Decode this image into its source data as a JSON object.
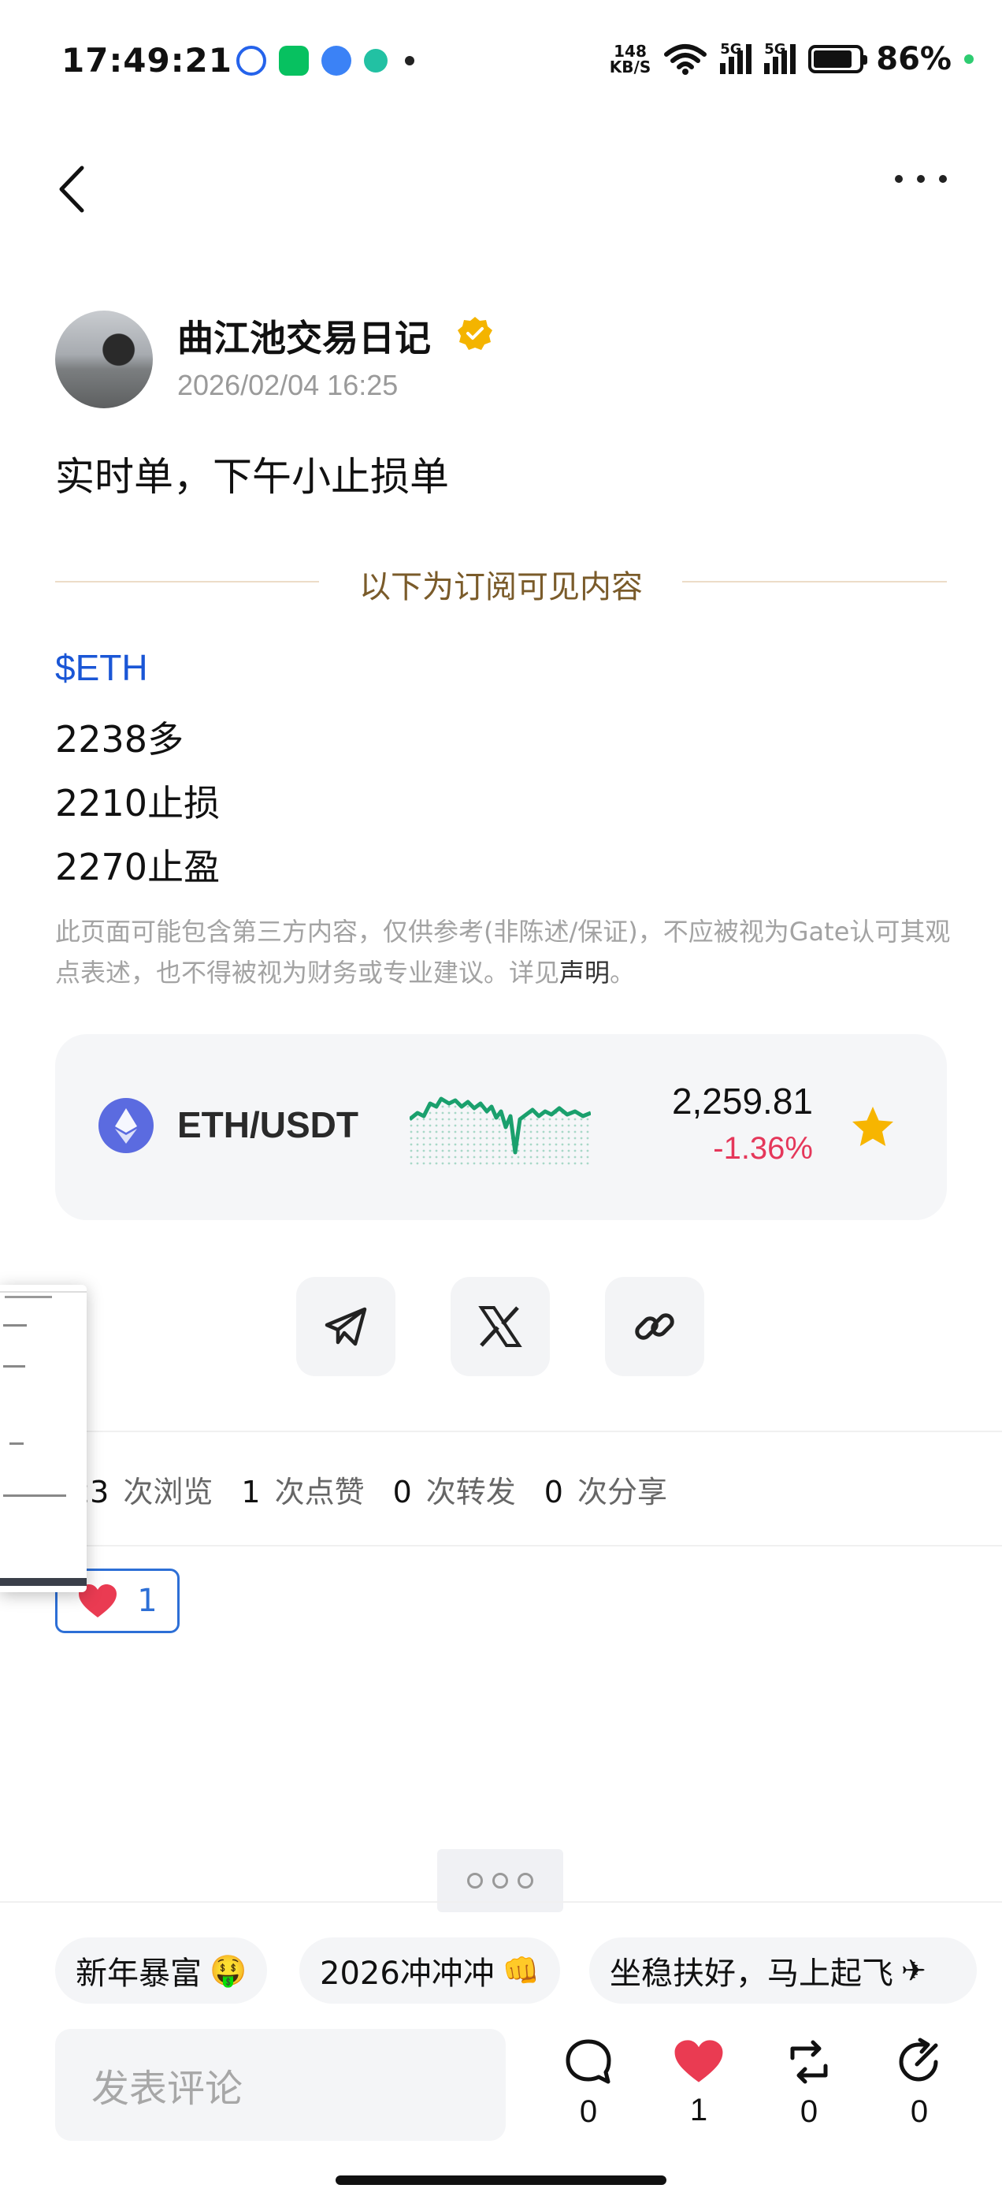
{
  "status_bar": {
    "time": "17:49:21",
    "net_speed_value": "148",
    "net_speed_unit": "KB/S",
    "signal1": "5G",
    "signal2": "5G",
    "battery": "86%"
  },
  "author": {
    "name": "曲江池交易日记",
    "time": "2026/02/04 16:25"
  },
  "post": {
    "title": "实时单，下午小止损单",
    "divider_text": "以下为订阅可见内容",
    "ticker": "$ETH",
    "lines": [
      "2238多",
      "2210止损",
      "2270止盈"
    ],
    "disclaimer": "此页面可能包含第三方内容，仅供参考(非陈述/保证)，不应被视为Gate认可其观点表述，也不得被视为财务或专业建议。详见",
    "disclaimer_link": "声明",
    "disclaimer_end": "。"
  },
  "ticker_card": {
    "pair": "ETH/USDT",
    "price": "2,259.81",
    "change": "-1.36%",
    "colors": {
      "up_line": "#1aa06d",
      "down": "#e5375a"
    }
  },
  "stats": [
    {
      "num": "23",
      "label": "次浏览"
    },
    {
      "num": "1",
      "label": "次点赞"
    },
    {
      "num": "0",
      "label": "次转发"
    },
    {
      "num": "0",
      "label": "次分享"
    }
  ],
  "like_pill": {
    "count": "1"
  },
  "tags": [
    {
      "text": "新年暴富",
      "emoji": "🤑"
    },
    {
      "text": "2026冲冲冲",
      "emoji": "👊"
    },
    {
      "text": "坐稳扶好，马上起飞",
      "emoji": "✈"
    }
  ],
  "bottom_bar": {
    "comment_placeholder": "发表评论",
    "comment_count": "0",
    "like_count": "1",
    "repost_count": "0",
    "share_count": "0"
  }
}
